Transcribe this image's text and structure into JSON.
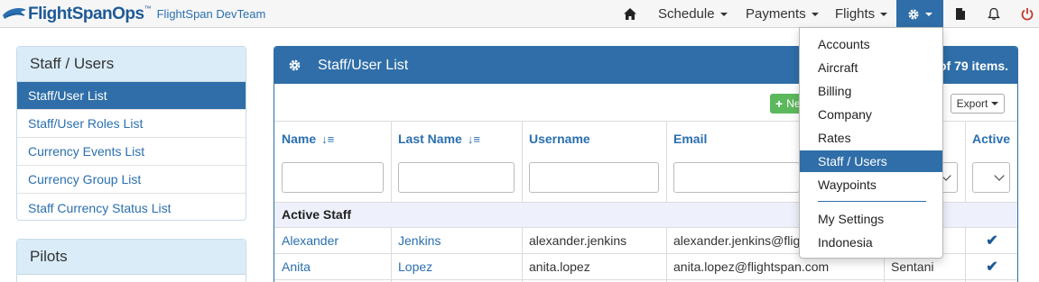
{
  "brand": {
    "name": "FlightSpanOps",
    "tm": "™",
    "team": "FlightSpan DevTeam"
  },
  "nav": {
    "schedule": "Schedule",
    "payments": "Payments",
    "flights": "Flights"
  },
  "sidebar": {
    "staff_title": "Staff / Users",
    "items": [
      {
        "label": "Staff/User List"
      },
      {
        "label": "Staff/User Roles List"
      },
      {
        "label": "Currency Events List"
      },
      {
        "label": "Currency Group List"
      },
      {
        "label": "Staff Currency Status List"
      }
    ],
    "pilots_title": "Pilots"
  },
  "main": {
    "title": "Staff/User List",
    "count_text": "of 79 items.",
    "new_label": "New",
    "export_label": "Export",
    "columns": {
      "name": "Name",
      "last_name": "Last Name",
      "username": "Username",
      "email": "Email",
      "active": "Active"
    },
    "group_label": "Active Staff",
    "rows": [
      {
        "name": "Alexander",
        "last_name": "Jenkins",
        "username": "alexander.jenkins",
        "email": "alexander.jenkins@flightspan.com",
        "base": "",
        "active": "✔"
      },
      {
        "name": "Anita",
        "last_name": "Lopez",
        "username": "anita.lopez",
        "email": "anita.lopez@flightspan.com",
        "base": "Sentani",
        "active": "✔"
      }
    ]
  },
  "dropdown": {
    "items": [
      {
        "label": "Accounts"
      },
      {
        "label": "Aircraft"
      },
      {
        "label": "Billing"
      },
      {
        "label": "Company"
      },
      {
        "label": "Rates"
      },
      {
        "label": "Staff / Users"
      },
      {
        "label": "Waypoints"
      }
    ],
    "settings": [
      {
        "label": "My Settings"
      },
      {
        "label": "Indonesia"
      }
    ]
  },
  "colors": {
    "primary": "#2f6ea8",
    "link": "#2a6fb0",
    "success": "#5cb85c",
    "danger": "#c0392b"
  }
}
